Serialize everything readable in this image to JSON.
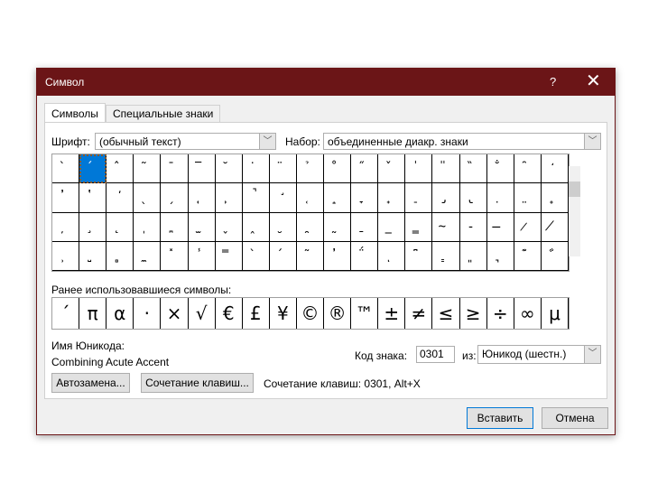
{
  "title": "Символ",
  "help": "?",
  "close": "✕",
  "tabs": [
    "Символы",
    "Специальные знаки"
  ],
  "font_label": "Шрифт:",
  "font_value": "(обычный текст)",
  "subset_label": "Набор:",
  "subset_value": "объединенные диакр. знаки",
  "grid": [
    "̀",
    "́",
    "̂",
    "̃",
    "̄",
    "̅",
    "̆",
    "̇",
    "̈",
    "̉",
    "̊",
    "̋",
    "̌",
    "̍",
    "̎",
    "̏",
    "̐",
    "̑",
    "̒",
    "̓",
    "̔",
    "̕",
    "̖",
    "̗",
    "̘",
    "̙",
    "̚",
    "̛",
    "̜",
    "̝",
    "̞",
    "̟",
    "̠",
    "̡",
    "̢",
    "̣",
    "̤",
    "̥",
    "̦",
    "̧",
    "̨",
    "̩",
    "̪",
    "̫",
    "̬",
    "̭",
    "̮",
    "̯",
    "̰",
    "̱",
    "̲",
    "̳",
    "̴",
    "̵",
    "̶",
    "̷",
    "̸",
    "̹",
    "̺",
    "̻",
    "̼",
    "̽",
    "̾",
    "̿",
    "̀",
    "́",
    "͂",
    "̓",
    "̈́",
    "ͅ",
    "͆",
    "͇",
    "͈",
    "͉",
    "͊",
    "͋"
  ],
  "recent_label": "Ранее использовавшиеся символы:",
  "recent": [
    "´",
    "π",
    "α",
    "·",
    "×",
    "√",
    "€",
    "£",
    "¥",
    "©",
    "®",
    "™",
    "±",
    "≠",
    "≤",
    "≥",
    "÷",
    "∞",
    "μ"
  ],
  "unicode_name_label": "Имя Юникода:",
  "unicode_name": "Combining Acute Accent",
  "code_label": "Код знака:",
  "code_value": "0301",
  "from_label": "из:",
  "from_value": "Юникод (шестн.)",
  "autocorrect": "Автозамена...",
  "shortcut_btn": "Сочетание клавиш...",
  "shortcut_text": "Сочетание клавиш: 0301, Alt+X",
  "insert": "Вставить",
  "cancel": "Отмена"
}
